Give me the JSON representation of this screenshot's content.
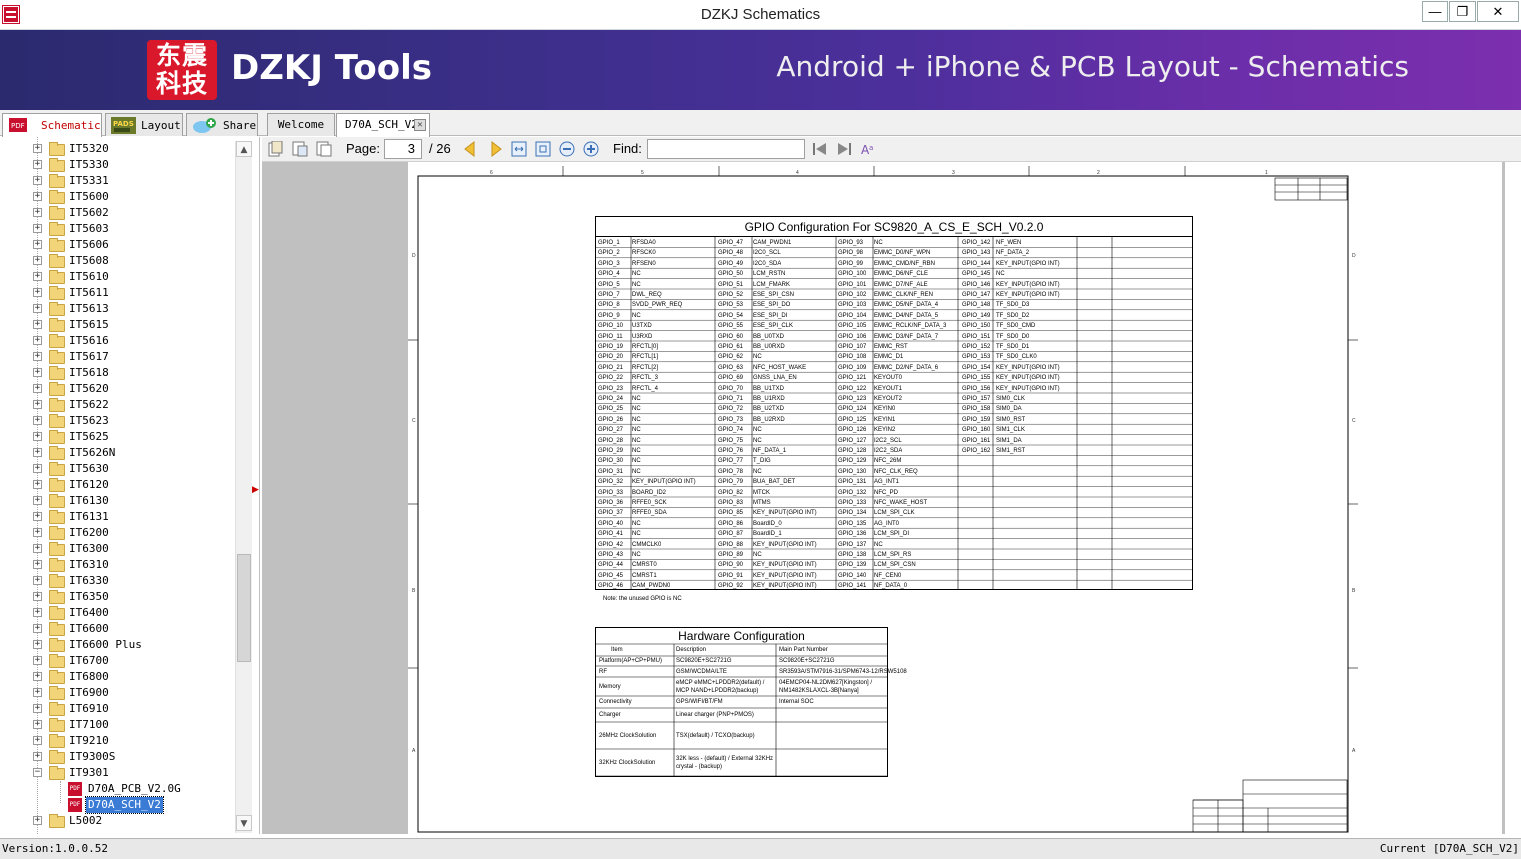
{
  "window": {
    "title": "DZKJ Schematics",
    "min": "—",
    "max": "❐",
    "close": "✕"
  },
  "banner": {
    "logo_top": "东震",
    "logo_bottom": "科技",
    "brand": "DZKJ Tools",
    "tagline": "Android + iPhone & PCB Layout - Schematics"
  },
  "tabs": {
    "schematic": "Schematic",
    "layout": "Layout",
    "share": "Share",
    "welcome": "Welcome",
    "doc": "D70A_SCH_V2"
  },
  "toolbar": {
    "page_label": "Page:",
    "page_value": "3",
    "page_total": "/ 26",
    "find_label": "Find:",
    "find_value": ""
  },
  "tree": [
    {
      "name": "IT5320"
    },
    {
      "name": "IT5330"
    },
    {
      "name": "IT5331"
    },
    {
      "name": "IT5600"
    },
    {
      "name": "IT5602"
    },
    {
      "name": "IT5603"
    },
    {
      "name": "IT5606"
    },
    {
      "name": "IT5608"
    },
    {
      "name": "IT5610"
    },
    {
      "name": "IT5611"
    },
    {
      "name": "IT5613"
    },
    {
      "name": "IT5615"
    },
    {
      "name": "IT5616"
    },
    {
      "name": "IT5617"
    },
    {
      "name": "IT5618"
    },
    {
      "name": "IT5620"
    },
    {
      "name": "IT5622"
    },
    {
      "name": "IT5623"
    },
    {
      "name": "IT5625"
    },
    {
      "name": "IT5626N"
    },
    {
      "name": "IT5630"
    },
    {
      "name": "IT6120"
    },
    {
      "name": "IT6130"
    },
    {
      "name": "IT6131"
    },
    {
      "name": "IT6200"
    },
    {
      "name": "IT6300"
    },
    {
      "name": "IT6310"
    },
    {
      "name": "IT6330"
    },
    {
      "name": "IT6350"
    },
    {
      "name": "IT6400"
    },
    {
      "name": "IT6600"
    },
    {
      "name": "IT6600 Plus"
    },
    {
      "name": "IT6700"
    },
    {
      "name": "IT6800"
    },
    {
      "name": "IT6900"
    },
    {
      "name": "IT6910"
    },
    {
      "name": "IT7100"
    },
    {
      "name": "IT9210"
    },
    {
      "name": "IT9300S"
    },
    {
      "name": "IT9301"
    },
    {
      "name": "D70A_PCB_V2.0G"
    },
    {
      "name": "D70A_SCH_V2"
    },
    {
      "name": "L5002"
    }
  ],
  "status": {
    "version": "Version:1.0.0.52",
    "current": "Current [D70A_SCH_V2]"
  },
  "schematic": {
    "gpio_title": "GPIO Configuration For  SC9820_A_CS_E_SCH_V0.2.0",
    "note": "Note: the unused GPIO is NC",
    "hw_title": "Hardware Configuration",
    "hw_headers": [
      "Item",
      "Description",
      "Main Part Number"
    ],
    "hw_rows": [
      [
        "Platform(AP+CP+PMU)",
        "SC9820E+SC2721G",
        "SC9820E+SC2721G"
      ],
      [
        "RF",
        "GSM/WCDMA/LTE",
        "SR3593A/STM7916-31/SPM6743-12/RSW5108"
      ],
      [
        "Memory",
        "eMCP eMMC+LPDDR2(default) / MCP NAND+LPDDR2(backup)",
        "04EMCP04-NL2DM627[Kingston] / NM1482KSLAXCL-3B[Nanya]"
      ],
      [
        "Connectivity",
        "GPS/WIFI/BT/FM",
        "Internal SOC"
      ],
      [
        "Charger",
        "Linear charger (PNP+PMOS)",
        ""
      ],
      [
        "26MHz ClockSolution",
        "TSX(default) / TCXO(backup)",
        ""
      ],
      [
        "32KHz ClockSolution",
        "32K less - (default) / External 32KHz crystal - (backup)",
        ""
      ]
    ],
    "col1": [
      [
        "GPIO_1",
        "RFSDA0"
      ],
      [
        "GPIO_2",
        "RFSCK0"
      ],
      [
        "GPIO_3",
        "RFSEN0"
      ],
      [
        "GPIO_4",
        "NC"
      ],
      [
        "GPIO_5",
        "NC"
      ],
      [
        "GPIO_7",
        "DWL_REQ"
      ],
      [
        "GPIO_8",
        "SVDD_PWR_REQ"
      ],
      [
        "GPIO_9",
        "NC"
      ],
      [
        "GPIO_10",
        "U3TXD"
      ],
      [
        "GPIO_11",
        "U3RXD"
      ],
      [
        "GPIO_19",
        "RFCTL[0]"
      ],
      [
        "GPIO_20",
        "RFCTL[1]"
      ],
      [
        "GPIO_21",
        "RFCTL[2]"
      ],
      [
        "GPIO_22",
        "RFCTL_3"
      ],
      [
        "GPIO_23",
        "RFCTL_4"
      ],
      [
        "GPIO_24",
        "NC"
      ],
      [
        "GPIO_25",
        "NC"
      ],
      [
        "GPIO_26",
        "NC"
      ],
      [
        "GPIO_27",
        "NC"
      ],
      [
        "GPIO_28",
        "NC"
      ],
      [
        "GPIO_29",
        "NC"
      ],
      [
        "GPIO_30",
        "NC"
      ],
      [
        "GPIO_31",
        "NC"
      ],
      [
        "GPIO_32",
        "KEY_INPUT(GPIO INT)"
      ],
      [
        "GPIO_33",
        "BOARD_ID2"
      ],
      [
        "GPIO_36",
        "RFFE0_SCK"
      ],
      [
        "GPIO_37",
        "RFFE0_SDA"
      ],
      [
        "GPIO_40",
        "NC"
      ],
      [
        "GPIO_41",
        "NC"
      ],
      [
        "GPIO_42",
        "CMMCLK0"
      ],
      [
        "GPIO_43",
        "NC"
      ],
      [
        "GPIO_44",
        "CMRST0"
      ],
      [
        "GPIO_45",
        "CMRST1"
      ],
      [
        "GPIO_46",
        "CAM_PWDN0"
      ]
    ],
    "col2": [
      [
        "GPIO_47",
        "CAM_PWDN1"
      ],
      [
        "GPIO_48",
        "I2C0_SCL"
      ],
      [
        "GPIO_49",
        "I2C0_SDA"
      ],
      [
        "GPIO_50",
        "LCM_RSTN"
      ],
      [
        "GPIO_51",
        "LCM_FMARK"
      ],
      [
        "GPIO_52",
        "ESE_SPI_CSN"
      ],
      [
        "GPIO_53",
        "ESE_SPI_DO"
      ],
      [
        "GPIO_54",
        "ESE_SPI_DI"
      ],
      [
        "GPIO_55",
        "ESE_SPI_CLK"
      ],
      [
        "GPIO_60",
        "BB_U0TXD"
      ],
      [
        "GPIO_61",
        "BB_U0RXD"
      ],
      [
        "GPIO_62",
        "NC"
      ],
      [
        "GPIO_63",
        "NFC_HOST_WAKE"
      ],
      [
        "GPIO_69",
        "GNSS_LNA_EN"
      ],
      [
        "GPIO_70",
        "BB_U1TXD"
      ],
      [
        "GPIO_71",
        "BB_U1RXD"
      ],
      [
        "GPIO_72",
        "BB_U2TXD"
      ],
      [
        "GPIO_73",
        "BB_U2RXD"
      ],
      [
        "GPIO_74",
        "NC"
      ],
      [
        "GPIO_75",
        "NC"
      ],
      [
        "GPIO_76",
        "NF_DATA_1"
      ],
      [
        "GPIO_77",
        "T_DIG"
      ],
      [
        "GPIO_78",
        "NC"
      ],
      [
        "GPIO_79",
        "BUA_BAT_DET"
      ],
      [
        "GPIO_82",
        "MTCK"
      ],
      [
        "GPIO_83",
        "MTMS"
      ],
      [
        "GPIO_85",
        "KEY_INPUT(GPIO INT)"
      ],
      [
        "GPIO_86",
        "BoardID_0"
      ],
      [
        "GPIO_87",
        "BoardID_1"
      ],
      [
        "GPIO_88",
        "KEY_INPUT(GPIO INT)"
      ],
      [
        "GPIO_89",
        "NC"
      ],
      [
        "GPIO_90",
        "KEY_INPUT(GPIO INT)"
      ],
      [
        "GPIO_91",
        "KEY_INPUT(GPIO INT)"
      ],
      [
        "GPIO_92",
        "KEY_INPUT(GPIO INT)"
      ]
    ],
    "col3": [
      [
        "GPIO_93",
        "NC"
      ],
      [
        "GPIO_98",
        "EMMC_D0/NF_WPN"
      ],
      [
        "GPIO_99",
        "EMMC_CMD/NF_RBN"
      ],
      [
        "GPIO_100",
        "EMMC_D6/NF_CLE"
      ],
      [
        "GPIO_101",
        "EMMC_D7/NF_ALE"
      ],
      [
        "GPIO_102",
        "EMMC_CLK/NF_REN"
      ],
      [
        "GPIO_103",
        "EMMC_D5/NF_DATA_4"
      ],
      [
        "GPIO_104",
        "EMMC_D4/NF_DATA_5"
      ],
      [
        "GPIO_105",
        "EMMC_RCLK/NF_DATA_3"
      ],
      [
        "GPIO_106",
        "EMMC_D3/NF_DATA_7"
      ],
      [
        "GPIO_107",
        "EMMC_RST"
      ],
      [
        "GPIO_108",
        "EMMC_D1"
      ],
      [
        "GPIO_109",
        "EMMC_D2/NF_DATA_6"
      ],
      [
        "GPIO_121",
        "KEYOUT0"
      ],
      [
        "GPIO_122",
        "KEYOUT1"
      ],
      [
        "GPIO_123",
        "KEYOUT2"
      ],
      [
        "GPIO_124",
        "KEYIN0"
      ],
      [
        "GPIO_125",
        "KEYIN1"
      ],
      [
        "GPIO_126",
        "KEYIN2"
      ],
      [
        "GPIO_127",
        "I2C2_SCL"
      ],
      [
        "GPIO_128",
        "I2C2_SDA"
      ],
      [
        "GPIO_129",
        "NFC_26M"
      ],
      [
        "GPIO_130",
        "NFC_CLK_REQ"
      ],
      [
        "GPIO_131",
        "AG_INT1"
      ],
      [
        "GPIO_132",
        "NFC_PD"
      ],
      [
        "GPIO_133",
        "NFC_WAKE_HOST"
      ],
      [
        "GPIO_134",
        "LCM_SPI_CLK"
      ],
      [
        "GPIO_135",
        "AG_INT0"
      ],
      [
        "GPIO_136",
        "LCM_SPI_DI"
      ],
      [
        "GPIO_137",
        "NC"
      ],
      [
        "GPIO_138",
        "LCM_SPI_RS"
      ],
      [
        "GPIO_139",
        "LCM_SPI_CSN"
      ],
      [
        "GPIO_140",
        "NF_CEN0"
      ],
      [
        "GPIO_141",
        "NF_DATA_0"
      ]
    ],
    "col4": [
      [
        "GPIO_142",
        "NF_WEN"
      ],
      [
        "GPIO_143",
        "NF_DATA_2"
      ],
      [
        "GPIO_144",
        "KEY_INPUT(GPIO INT)"
      ],
      [
        "GPIO_145",
        "NC"
      ],
      [
        "GPIO_146",
        "KEY_INPUT(GPIO INT)"
      ],
      [
        "GPIO_147",
        "KEY_INPUT(GPIO INT)"
      ],
      [
        "GPIO_148",
        "TF_SD0_D3"
      ],
      [
        "GPIO_149",
        "TF_SD0_D2"
      ],
      [
        "GPIO_150",
        "TF_SD0_CMD"
      ],
      [
        "GPIO_151",
        "TF_SD0_D0"
      ],
      [
        "GPIO_152",
        "TF_SD0_D1"
      ],
      [
        "GPIO_153",
        "TF_SD0_CLK0"
      ],
      [
        "GPIO_154",
        "KEY_INPUT(GPIO INT)"
      ],
      [
        "GPIO_155",
        "KEY_INPUT(GPIO INT)"
      ],
      [
        "GPIO_156",
        "KEY_INPUT(GPIO INT)"
      ],
      [
        "GPIO_157",
        "SIM0_CLK"
      ],
      [
        "GPIO_158",
        "SIM0_DA"
      ],
      [
        "GPIO_159",
        "SIM0_RST"
      ],
      [
        "GPIO_160",
        "SIM1_CLK"
      ],
      [
        "GPIO_161",
        "SIM1_DA"
      ],
      [
        "GPIO_162",
        "SIM1_RST"
      ]
    ]
  }
}
